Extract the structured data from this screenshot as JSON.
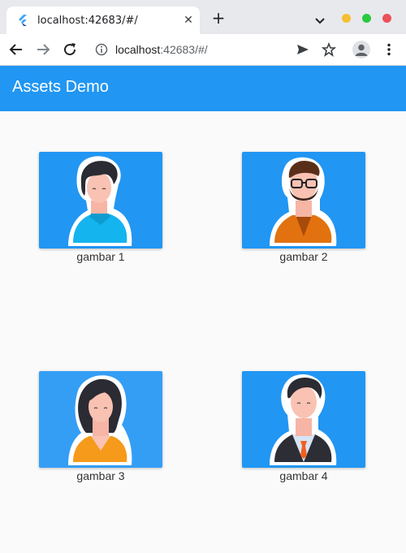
{
  "browser": {
    "tab_title": "localhost:42683/#/",
    "tab_close": "✕",
    "new_tab": "+",
    "url_host": "localhost",
    "url_rest": ":42683/#/",
    "colors": {
      "min": "#f6be31",
      "max": "#2ac940",
      "close": "#ec4f58"
    }
  },
  "app": {
    "title": "Assets Demo",
    "accent": "#2196f3",
    "images": [
      {
        "caption": "gambar 1",
        "icon": "avatar-man-blue-sweater-icon"
      },
      {
        "caption": "gambar 2",
        "icon": "avatar-man-glasses-orange-jacket-icon"
      },
      {
        "caption": "gambar 3",
        "icon": "avatar-woman-orange-shirt-icon"
      },
      {
        "caption": "gambar 4",
        "icon": "avatar-man-suit-tie-icon"
      }
    ]
  }
}
